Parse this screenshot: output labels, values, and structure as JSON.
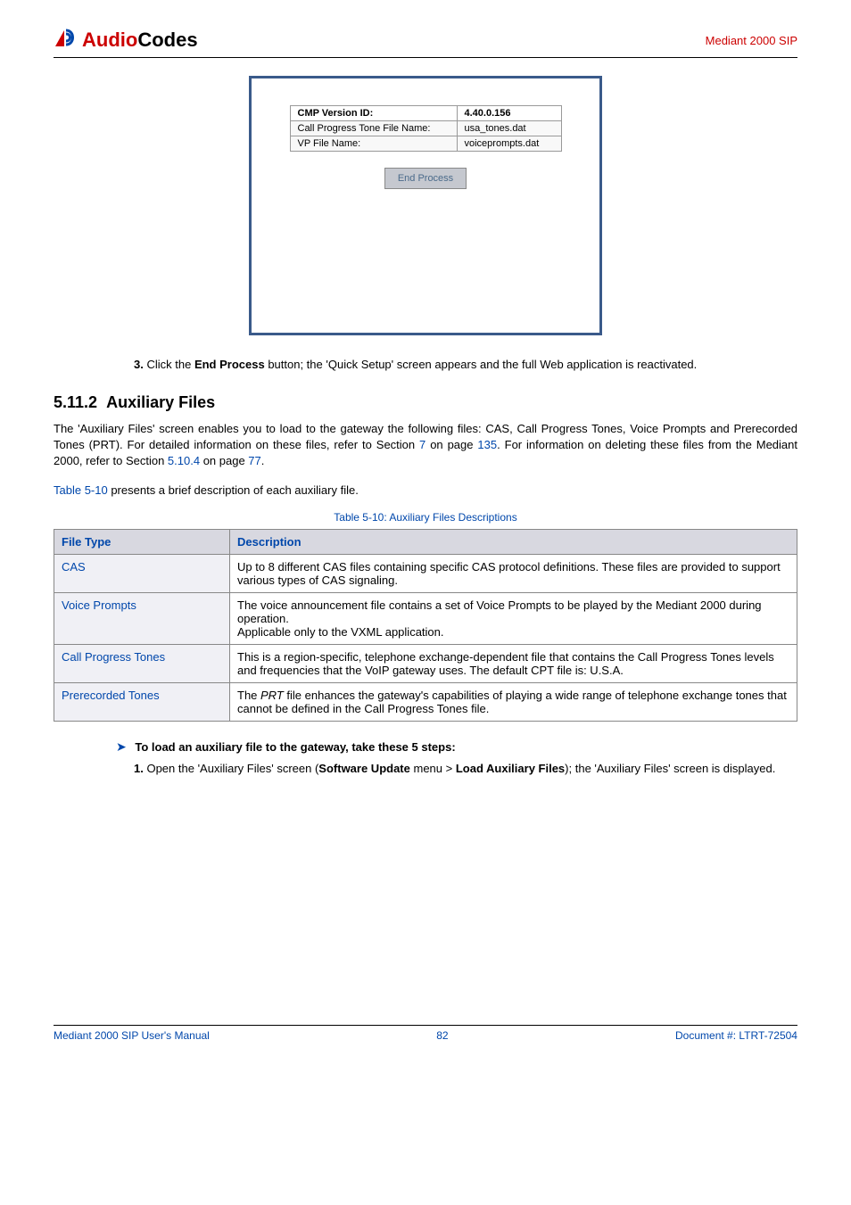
{
  "header": {
    "logo_text1": "Audio",
    "logo_text2": "Codes",
    "right": "Mediant 2000 SIP"
  },
  "screenshot": {
    "row1_label": "CMP Version ID:",
    "row1_value": "4.40.0.156",
    "row2_label": "Call Progress Tone File Name:",
    "row2_value": "usa_tones.dat",
    "row3_label": "VP File Name:",
    "row3_value": "voiceprompts.dat",
    "button": "End Process"
  },
  "step3": {
    "num": "3.",
    "part1": "Click the ",
    "bold": "End Process",
    "part2": " button; the 'Quick Setup' screen appears and the full Web application is reactivated."
  },
  "section": {
    "num": "5.11.2",
    "title": "Auxiliary Files"
  },
  "para1": {
    "t1": "The 'Auxiliary Files' screen enables you to load to the gateway the following files: CAS, Call Progress Tones, Voice Prompts and Prerecorded Tones (PRT). For detailed information on these files, refer to Section ",
    "l1": "7",
    "t2": " on page ",
    "l2": "135",
    "t3": ". For information on deleting these files from the Mediant 2000, refer to Section ",
    "l3": "5.10.4",
    "t4": " on page ",
    "l4": "77",
    "t5": "."
  },
  "para2": {
    "l1": "Table 5-10",
    "t1": " presents a brief description of each auxiliary file."
  },
  "table_caption": "Table 5-10: Auxiliary Files Descriptions",
  "table": {
    "header": {
      "c1": "File Type",
      "c2": "Description"
    },
    "rows": [
      {
        "label": "CAS",
        "desc": "Up to 8 different CAS files containing specific CAS protocol definitions. These files are provided to support various types of CAS signaling."
      },
      {
        "label": "Voice Prompts",
        "desc": "The voice announcement file contains a set of Voice Prompts to be played by the Mediant 2000 during operation.\nApplicable only to the VXML application."
      },
      {
        "label": "Call Progress Tones",
        "desc": "This is a region-specific, telephone exchange-dependent file that contains the Call Progress Tones levels and frequencies that the VoIP gateway uses. The default CPT file is: U.S.A."
      },
      {
        "label": "Prerecorded Tones",
        "desc_pre": "The ",
        "desc_italic": "PRT",
        "desc_post": " file enhances the gateway's capabilities of playing a wide range of telephone exchange tones that cannot be defined in the Call Progress Tones file."
      }
    ]
  },
  "load": {
    "arrow": "➤",
    "title": "To load an auxiliary file to the gateway, take these 5 steps:",
    "step": {
      "num": "1.",
      "t1": "Open the 'Auxiliary Files' screen (",
      "b1": "Software Update",
      "t2": " menu > ",
      "b2": "Load Auxiliary Files",
      "t3": "); the 'Auxiliary Files' screen is displayed."
    }
  },
  "footer": {
    "left": "Mediant 2000 SIP User's Manual",
    "center": "82",
    "right": "Document #: LTRT-72504"
  }
}
